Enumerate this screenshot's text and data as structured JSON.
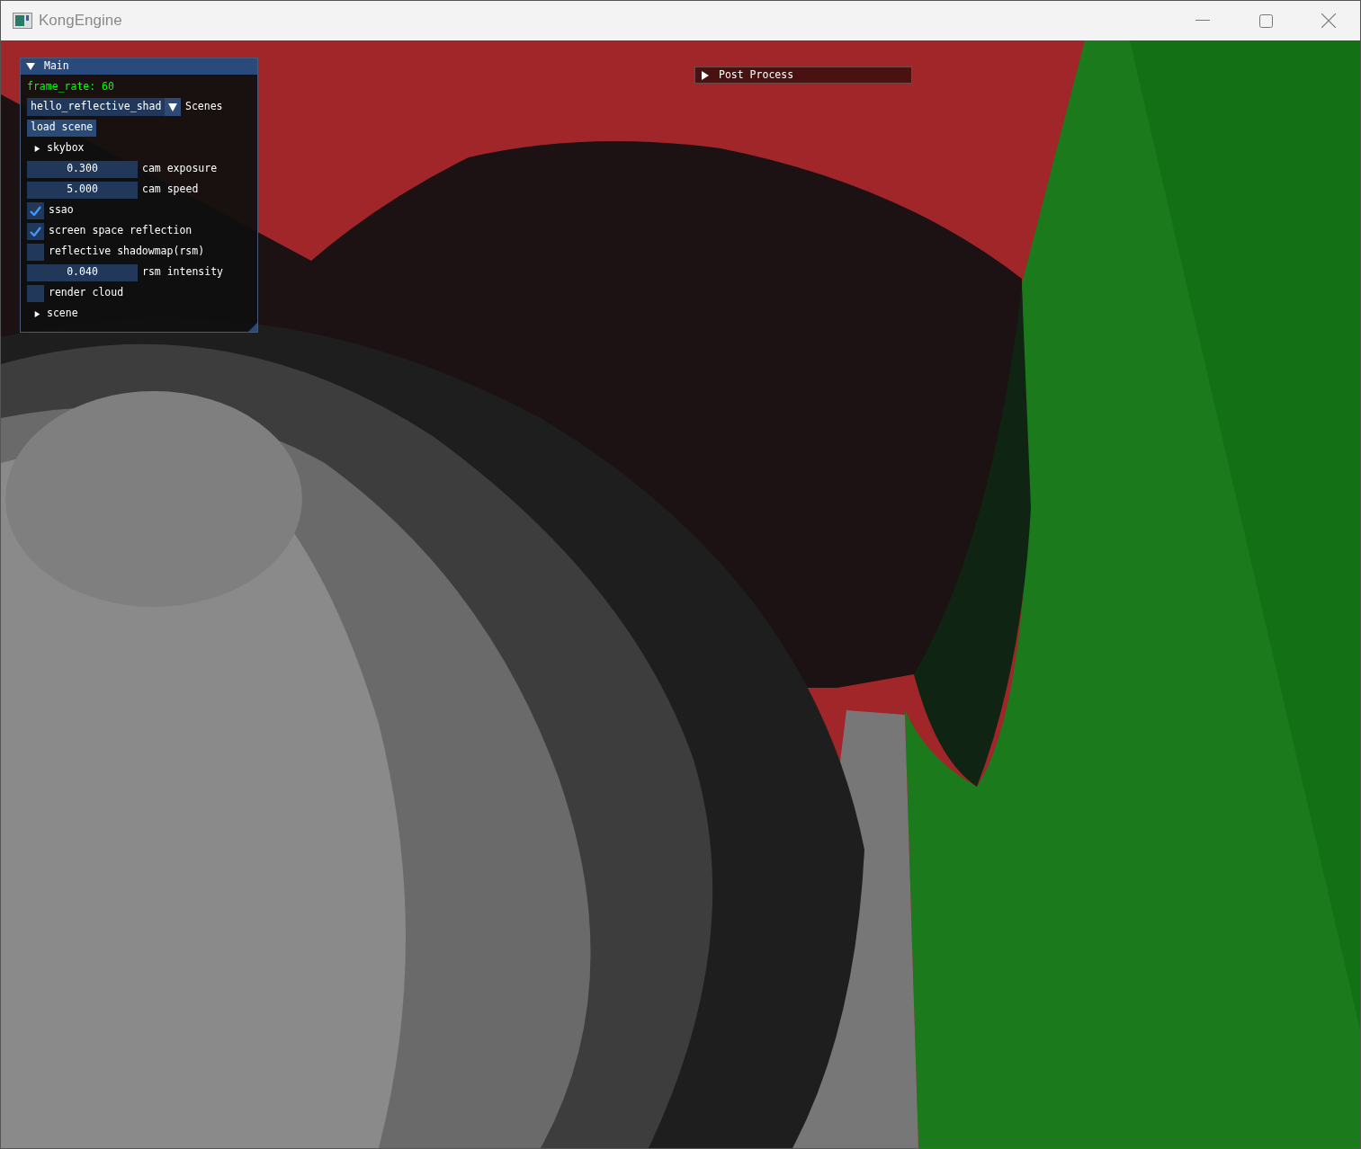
{
  "window": {
    "title": "KongEngine"
  },
  "main_panel": {
    "title": "Main",
    "expanded": true,
    "items": [
      {
        "kind": "stat",
        "text": "frame_rate: 60"
      },
      {
        "kind": "combo",
        "value": "hello_reflective_shad",
        "label": "Scenes"
      },
      {
        "kind": "button",
        "label": "load scene"
      },
      {
        "kind": "tree",
        "label": "skybox",
        "expanded": false
      },
      {
        "kind": "drag",
        "label": "cam exposure",
        "field": {
          "value": "0.300"
        }
      },
      {
        "kind": "drag",
        "label": "cam speed",
        "field": {
          "value": "5.000"
        }
      },
      {
        "kind": "checkbox",
        "label": "ssao",
        "checked": true
      },
      {
        "kind": "checkbox",
        "label": "screen space reflection",
        "checked": true
      },
      {
        "kind": "checkbox",
        "label": "reflective shadowmap(rsm)",
        "checked": false
      },
      {
        "kind": "drag",
        "label": "rsm intensity",
        "field": {
          "value": "0.040"
        }
      },
      {
        "kind": "checkbox",
        "label": "render cloud",
        "checked": false
      },
      {
        "kind": "tree",
        "label": "scene",
        "expanded": false
      }
    ]
  },
  "post_process": {
    "title": "Post Process",
    "expanded": false
  }
}
